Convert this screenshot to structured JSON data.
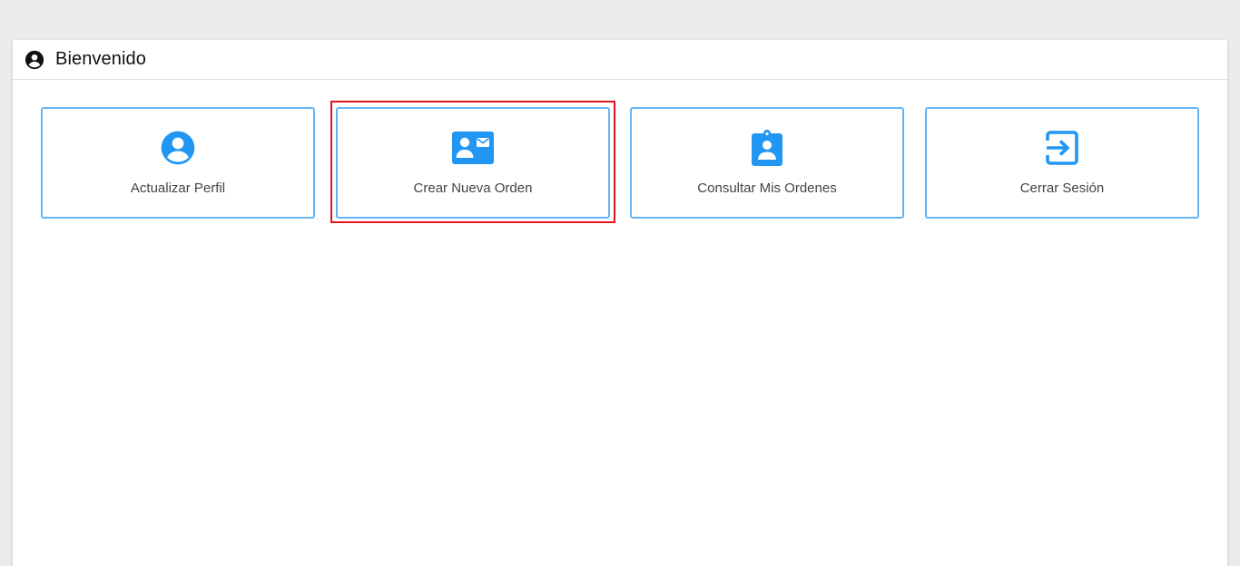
{
  "header": {
    "icon": "account-circle-icon",
    "title": "Bienvenido"
  },
  "tiles": [
    {
      "icon": "account-circle-icon",
      "label": "Actualizar Perfil"
    },
    {
      "icon": "contact-mail-icon",
      "label": "Crear Nueva Orden"
    },
    {
      "icon": "clipboard-account-icon",
      "label": "Consultar Mis Ordenes"
    },
    {
      "icon": "exit-to-app-icon",
      "label": "Cerrar Sesión"
    }
  ],
  "colors": {
    "accent": "#2196f3",
    "tile_border": "#64b5f6",
    "highlight": "#e0161f",
    "background": "#ebebeb"
  },
  "highlighted_tile": "Crear Nueva Orden"
}
